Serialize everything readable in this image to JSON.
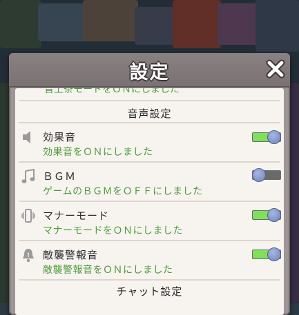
{
  "dialog": {
    "title": "設定",
    "cut_text": "音上条モードをＯＮにしました"
  },
  "sections": {
    "sound": "音声設定",
    "chat": "チャット設定"
  },
  "settings": [
    {
      "label": "効果音",
      "status": "効果音をＯＮにしました",
      "state": "on",
      "icon": "speaker-icon"
    },
    {
      "label": "ＢＧＭ",
      "status": "ゲームのＢＧＭをＯＦＦにしました",
      "state": "off",
      "icon": "music-note-icon"
    },
    {
      "label": "マナーモード",
      "status": "マナーモードをＯＮにしました",
      "state": "on",
      "icon": "vibrate-icon"
    },
    {
      "label": "敵襲警報音",
      "status": "敵襲警報音をＯＮにしました",
      "state": "on",
      "icon": "alarm-bell-icon"
    }
  ],
  "colors": {
    "status_text": "#4f9a3a",
    "toggle_on": "#7fe05a",
    "toggle_off": "#6a6a6a",
    "panel_bg": "#f7f4f0",
    "frame": "#9d9596"
  }
}
